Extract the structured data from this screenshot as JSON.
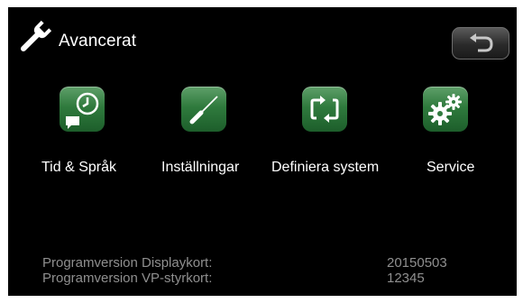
{
  "header": {
    "title": "Avancerat",
    "icon": "wrench-icon",
    "back_icon": "back-arrow-icon"
  },
  "menu": {
    "items": [
      {
        "label": "Tid & Språk",
        "icon": "clock-speech-icon"
      },
      {
        "label": "Inställningar",
        "icon": "screwdriver-icon"
      },
      {
        "label": "Definiera system",
        "icon": "cycle-arrows-icon"
      },
      {
        "label": "Service",
        "icon": "gears-icon"
      }
    ]
  },
  "info": {
    "display_label": "Programversion Displaykort:",
    "display_value": "20150503",
    "vp_label": "Programversion VP-styrkort:",
    "vp_value": "12345"
  },
  "colors": {
    "background": "#000000",
    "tile_green": "#2f7a3d",
    "text": "#ffffff",
    "info_text": "#8f8f8f"
  }
}
